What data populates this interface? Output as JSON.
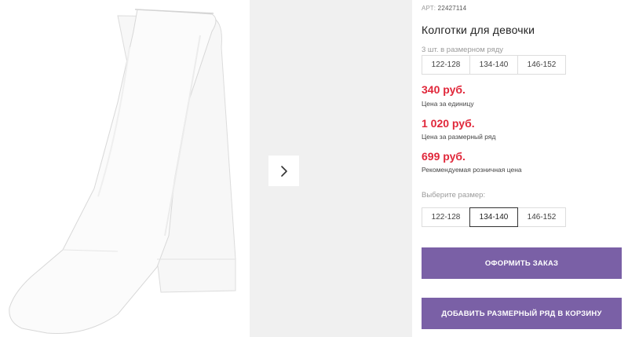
{
  "product": {
    "article_label": "АРТ:",
    "article_number": "22427114",
    "title": "Колготки для девочки"
  },
  "pack": {
    "label": "3 шт. в размерном ряду",
    "sizes": [
      "122-128",
      "134-140",
      "146-152"
    ]
  },
  "prices": {
    "unit_price": "340 руб.",
    "unit_label": "Цена за единицу",
    "pack_price": "1 020 руб.",
    "pack_label": "Цена за размерный ряд",
    "retail_price": "699 руб.",
    "retail_label": "Рекомендуемая розничная цена"
  },
  "size_select": {
    "label": "Выберите размер:",
    "options": [
      "122-128",
      "134-140",
      "146-152"
    ],
    "selected": "134-140"
  },
  "actions": {
    "order_label": "ОФОРМИТЬ ЗАКАЗ",
    "cart_label": "ДОБАВИТЬ РАЗМЕРНЫЙ РЯД В КОРЗИНУ"
  },
  "icons": {
    "next": "chevron-right-icon"
  },
  "colors": {
    "price": "#e0273a",
    "button": "#7a60a6",
    "thumb_bg": "#f0f0f0"
  }
}
